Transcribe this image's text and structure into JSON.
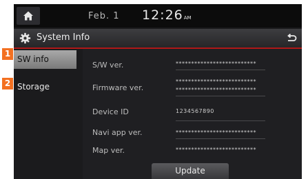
{
  "status": {
    "date": "Feb.  1",
    "time": "12:26",
    "ampm": "AM"
  },
  "header": {
    "title": "System Info"
  },
  "sidebar": {
    "items": [
      {
        "label": "SW info",
        "active": true
      },
      {
        "label": "Storage",
        "active": false
      }
    ]
  },
  "callouts": [
    "1",
    "2"
  ],
  "info": {
    "sw_ver_label": "S/W ver.",
    "sw_ver_value": "**************************",
    "firmware_label": "Firmware ver.",
    "firmware_value_1": "**************************",
    "firmware_value_2": "**************************",
    "device_id_label": "Device ID",
    "device_id_value": "1234567890",
    "navi_label": "Navi app ver.",
    "navi_value": "**************************",
    "map_label": "Map ver.",
    "map_value": "**************************"
  },
  "actions": {
    "update_label": "Update"
  },
  "icons": {
    "home": "home-icon",
    "settings": "gear-icon",
    "back": "back-arrow-icon"
  },
  "colors": {
    "accent": "#b01818",
    "callout": "#f37021"
  }
}
